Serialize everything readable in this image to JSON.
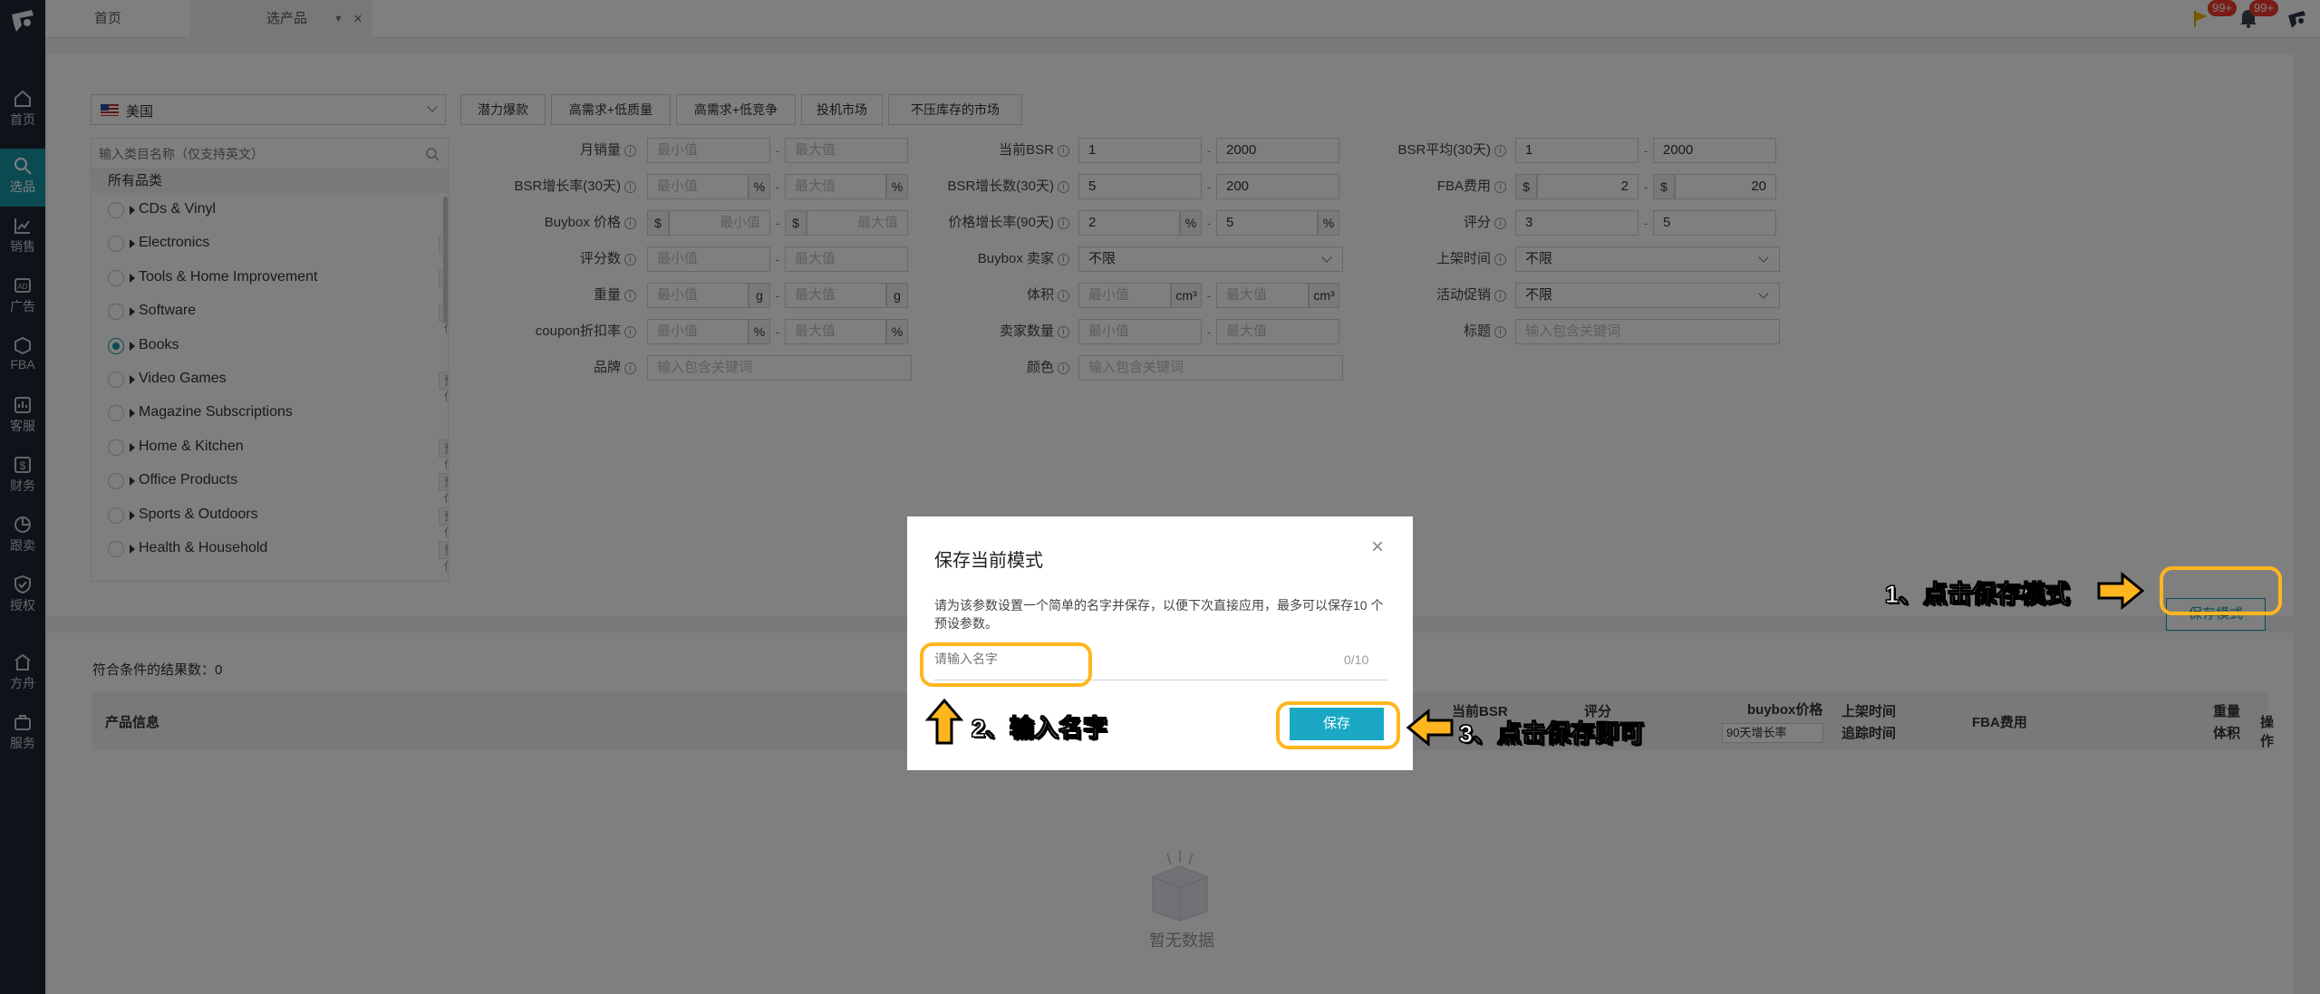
{
  "sidebar": {
    "items": [
      {
        "label": "首页",
        "icon": "home-icon"
      },
      {
        "label": "选品",
        "icon": "select-product-icon",
        "active": true
      },
      {
        "label": "销售",
        "icon": "sales-chart-icon"
      },
      {
        "label": "广告",
        "icon": "ad-icon"
      },
      {
        "label": "FBA",
        "icon": "fba-box-icon"
      },
      {
        "label": "客服",
        "icon": "service-icon"
      },
      {
        "label": "财务",
        "icon": "finance-icon"
      },
      {
        "label": "跟卖",
        "icon": "follow-sell-icon"
      },
      {
        "label": "授权",
        "icon": "shield-icon"
      },
      {
        "label": "方舟",
        "icon": "ark-icon"
      },
      {
        "label": "服务",
        "icon": "service-bag-icon"
      }
    ]
  },
  "topbar": {
    "tabs": [
      "首页",
      "选产品"
    ],
    "badge_count_1": "99+",
    "badge_count_2": "99+"
  },
  "filters": {
    "country": "美国",
    "presets": [
      "潜力爆款",
      "高需求+低质量",
      "高需求+低竞争",
      "投机市场",
      "不压库存的市场"
    ],
    "category_search_placeholder": "输入类目名称（仅支持英文）",
    "all_categories": "所有品类",
    "categories": [
      {
        "name": "CDs & Vinyl",
        "badge": ""
      },
      {
        "name": "Electronics",
        "badge": "预估"
      },
      {
        "name": "Tools & Home Improvement",
        "badge": "预估"
      },
      {
        "name": "Software",
        "badge": "预估"
      },
      {
        "name": "Books",
        "badge": "",
        "checked": true
      },
      {
        "name": "Video Games",
        "badge": "预估"
      },
      {
        "name": "Magazine Subscriptions",
        "badge": ""
      },
      {
        "name": "Home & Kitchen",
        "badge": "预估"
      },
      {
        "name": "Office Products",
        "badge": "预估"
      },
      {
        "name": "Sports & Outdoors",
        "badge": "预估"
      },
      {
        "name": "Health & Household",
        "badge": "预估"
      }
    ],
    "min_placeholder": "最小值",
    "max_placeholder": "最大值",
    "keyword_placeholder": "输入包含关键词",
    "unlimited": "不限",
    "labels": {
      "monthly_sales": "月销量",
      "bsr_growth_rate": "BSR增长率(30天)",
      "buybox_price": "Buybox 价格",
      "review_count": "评分数",
      "weight": "重量",
      "coupon": "coupon折扣率",
      "brand": "品牌",
      "current_bsr": "当前BSR",
      "bsr_growth_count": "BSR增长数(30天)",
      "price_growth": "价格增长率(90天)",
      "buybox_seller": "Buybox 卖家",
      "volume": "体积",
      "seller_count": "卖家数量",
      "color": "颜色",
      "bsr_avg": "BSR平均(30天)",
      "fba_fee": "FBA费用",
      "rating": "评分",
      "launch_time": "上架时间",
      "promotion": "活动促销",
      "title": "标题"
    },
    "values": {
      "current_bsr_min": "1",
      "current_bsr_max": "2000",
      "bsr_avg_min": "1",
      "bsr_avg_max": "2000",
      "bsr_growth_count_min": "5",
      "bsr_growth_count_max": "200",
      "fba_min": "2",
      "fba_max": "20",
      "price_growth_min": "2",
      "price_growth_max": "5",
      "rating_min": "3",
      "rating_max": "5"
    },
    "units": {
      "percent": "%",
      "dollar": "$",
      "gram": "g",
      "cm3": "cm³"
    }
  },
  "save_mode_button": "保存模式",
  "results": {
    "count_label": "符合条件的结果数：0",
    "columns": {
      "product_info": "产品信息",
      "current_bsr": "当前BSR",
      "rating": "评分",
      "buybox_price": "buybox价格",
      "buybox_sub": "90天增长率",
      "launch_time": "上架时间",
      "track_time": "追踪时间",
      "fba_fee": "FBA费用",
      "weight": "重量",
      "volume": "体积",
      "actions": "操作"
    },
    "empty_text": "暂无数据"
  },
  "modal": {
    "title": "保存当前模式",
    "description": "请为该参数设置一个简单的名字并保存，以便下次直接应用，最多可以保存10 个预设参数。",
    "input_placeholder": "请输入名字",
    "char_count": "0/10",
    "save_button": "保存"
  },
  "annotations": {
    "step1": "1、点击保存模式",
    "step2": "2、输入名字",
    "step3": "3、点击保存即可"
  },
  "colors": {
    "accent": "#1894a4",
    "highlight": "#ffb61e",
    "sidebar": "#1d2733"
  }
}
